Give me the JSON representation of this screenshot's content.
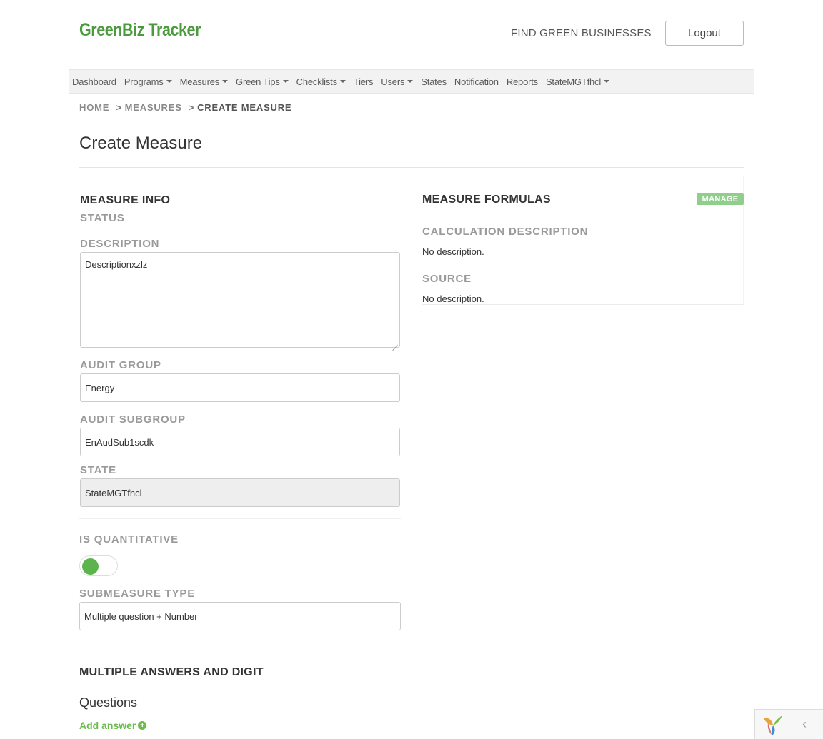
{
  "header": {
    "logo": "GreenBiz Tracker",
    "find_link": "FIND GREEN BUSINESSES",
    "logout_label": "Logout"
  },
  "nav": {
    "items": [
      {
        "label": "Dashboard",
        "dropdown": false
      },
      {
        "label": "Programs",
        "dropdown": true
      },
      {
        "label": "Measures",
        "dropdown": true
      },
      {
        "label": "Green Tips",
        "dropdown": true
      },
      {
        "label": "Checklists",
        "dropdown": true
      },
      {
        "label": "Tiers",
        "dropdown": false
      },
      {
        "label": "Users",
        "dropdown": true
      },
      {
        "label": "States",
        "dropdown": false
      },
      {
        "label": "Notification",
        "dropdown": false
      },
      {
        "label": "Reports",
        "dropdown": false
      },
      {
        "label": "StateMGTfhcl",
        "dropdown": true
      }
    ]
  },
  "breadcrumb": {
    "home": "HOME",
    "measures": "MEASURES",
    "current": "CREATE MEASURE",
    "separator": ">"
  },
  "page": {
    "title": "Create Measure"
  },
  "measure_info": {
    "heading": "MEASURE INFO",
    "status_label": "STATUS",
    "description_label": "DESCRIPTION",
    "description_value": "Descriptionxzlz",
    "audit_group_label": "AUDIT GROUP",
    "audit_group_value": "Energy",
    "audit_subgroup_label": "AUDIT SUBGROUP",
    "audit_subgroup_value": "EnAudSub1scdk",
    "state_label": "STATE",
    "state_value": "StateMGTfhcl"
  },
  "measure_formulas": {
    "heading": "MEASURE FORMULAS",
    "manage_label": "MANAGE",
    "calc_desc_label": "CALCULATION DESCRIPTION",
    "calc_desc_value": "No description.",
    "source_label": "SOURCE",
    "source_value": "No description."
  },
  "quantitative": {
    "label": "IS QUANTITATIVE",
    "toggle_on": true,
    "submeasure_label": "SUBMEASURE TYPE",
    "submeasure_value": "Multiple question + Number"
  },
  "multiple_answers": {
    "heading": "MULTIPLE ANSWERS AND DIGIT",
    "questions_heading": "Questions",
    "add_answer_label": "Add answer",
    "add_icon": "plus-circle-icon"
  },
  "debug_toolbar": {
    "logo_icon": "yii-logo-icon",
    "collapse_icon": "chevron-left-icon",
    "collapse_glyph": "‹"
  },
  "colors": {
    "brand_green": "#4c9a3e",
    "accent_green": "#5cb54c",
    "badge_green": "#8fce8b",
    "label_gray": "#9a9a9a"
  }
}
